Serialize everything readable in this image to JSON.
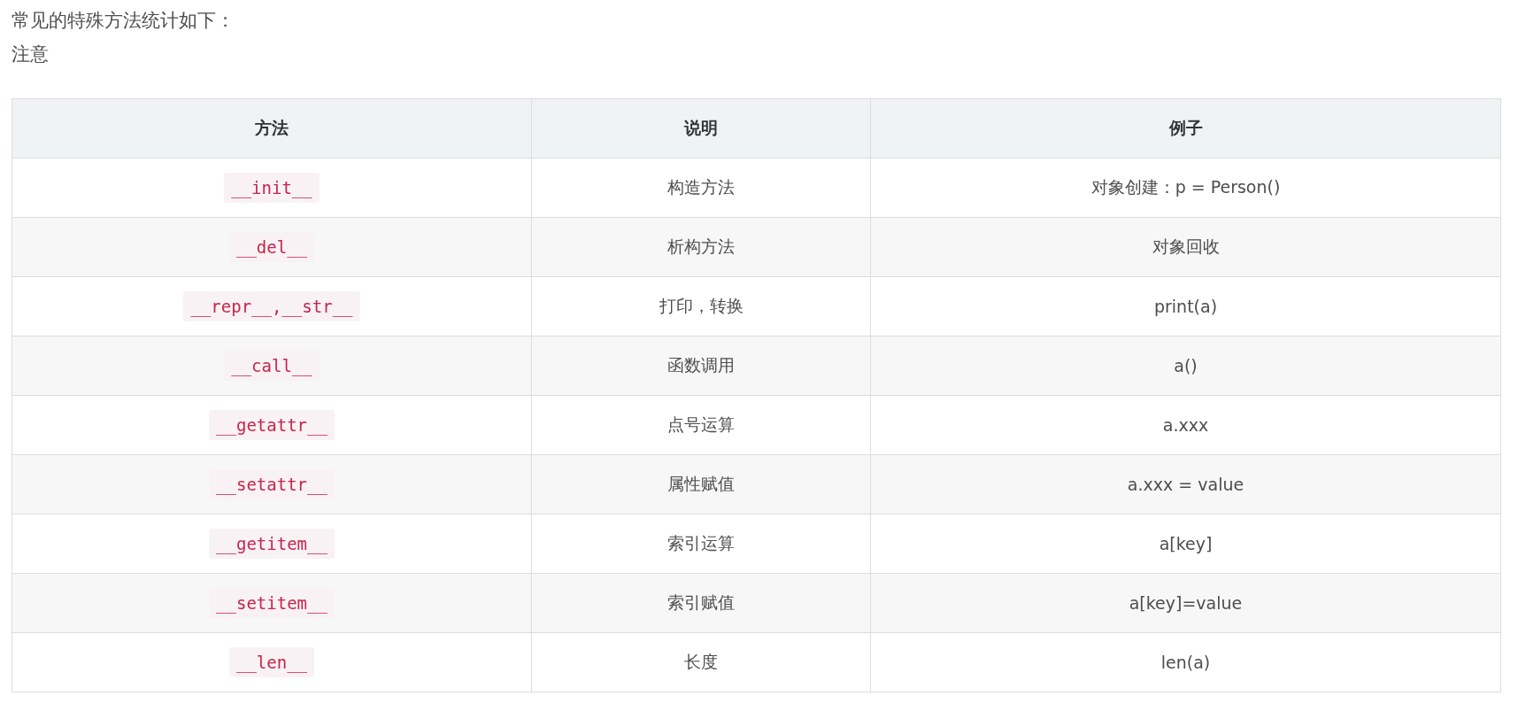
{
  "paragraphs": [
    "常见的特殊方法统计如下：",
    "注意"
  ],
  "table": {
    "columns": [
      "方法",
      "说明",
      "例子"
    ],
    "rows": [
      {
        "method": "__init__",
        "description": "构造方法",
        "example": "对象创建：p = Person()"
      },
      {
        "method": "__del__",
        "description": "析构方法",
        "example": "对象回收"
      },
      {
        "method": "__repr__,__str__",
        "description": "打印，转换",
        "example": "print(a)"
      },
      {
        "method": "__call__",
        "description": "函数调用",
        "example": "a()"
      },
      {
        "method": "__getattr__",
        "description": "点号运算",
        "example": "a.xxx"
      },
      {
        "method": "__setattr__",
        "description": "属性赋值",
        "example": "a.xxx = value"
      },
      {
        "method": "__getitem__",
        "description": "索引运算",
        "example": "a[key]"
      },
      {
        "method": "__setitem__",
        "description": "索引赋值",
        "example": "a[key]=value"
      },
      {
        "method": "__len__",
        "description": "长度",
        "example": "len(a)"
      }
    ]
  }
}
